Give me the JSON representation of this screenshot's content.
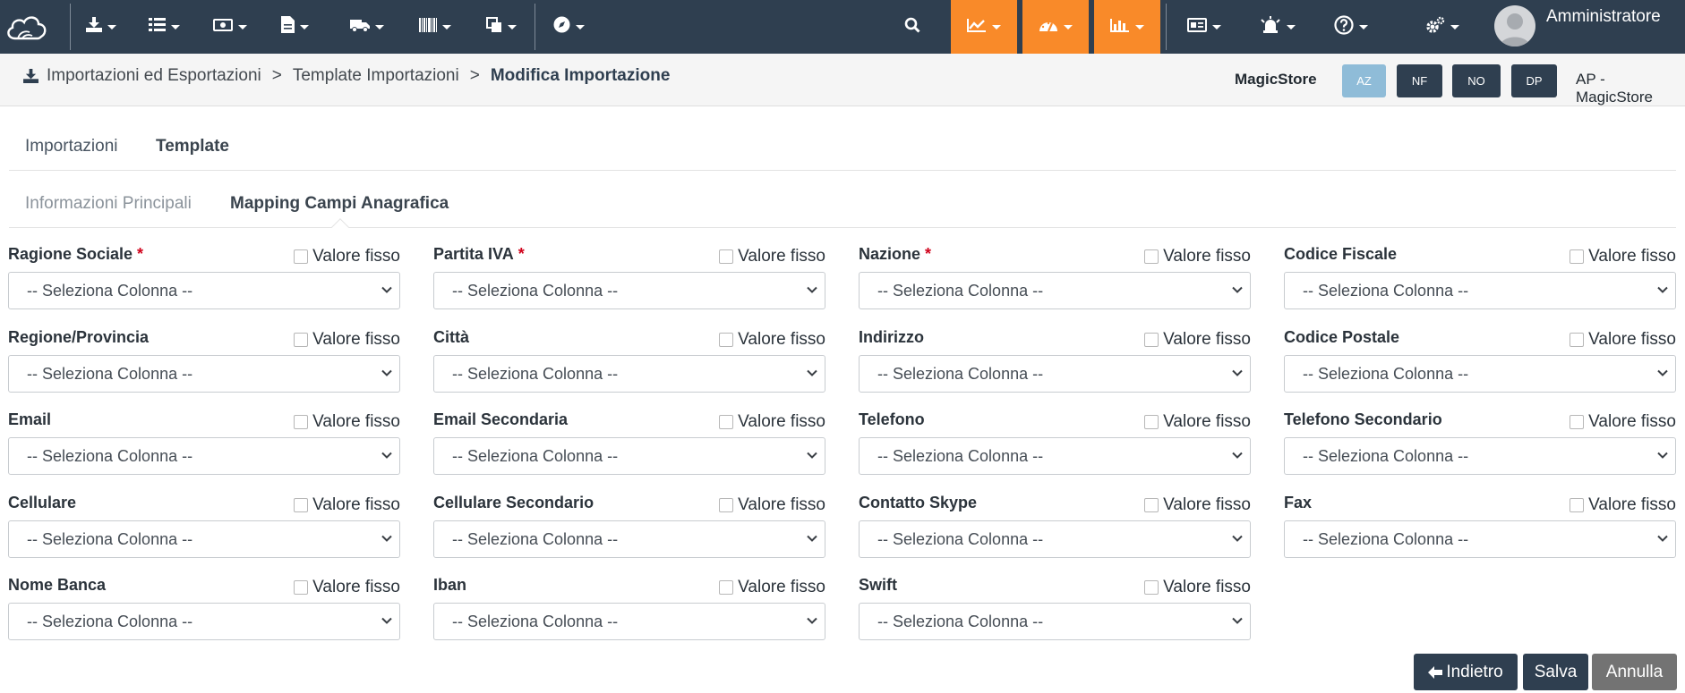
{
  "navbar": {
    "user_name": "Amministratore",
    "accent": "#f98a29",
    "background": "#2f3f50",
    "menu_icons": [
      "download-icon",
      "list-icon",
      "money-icon",
      "document-icon",
      "truck-icon",
      "barcode-icon",
      "copy-icon",
      "compass-icon",
      "search-icon",
      "line-chart-icon",
      "dashboard-icon",
      "bar-chart-icon",
      "id-card-icon",
      "alarm-icon",
      "help-icon",
      "settings-icon"
    ]
  },
  "breadcrumb": {
    "items": [
      "Importazioni ed Esportazioni",
      "Template Importazioni",
      "Modifica Importazione"
    ],
    "separator": ">"
  },
  "store": {
    "name": "MagicStore",
    "code_buttons": [
      "AZ",
      "NF",
      "NO",
      "DP"
    ],
    "code": "AP - MagicStore"
  },
  "tabs": {
    "top": [
      "Importazioni",
      "Template"
    ],
    "sub": [
      "Informazioni Principali",
      "Mapping Campi Anagrafica"
    ]
  },
  "fixed_label": "Valore fisso",
  "select_placeholder": "-- Seleziona Colonna --",
  "fields": [
    {
      "label": "Ragione Sociale",
      "required": "*"
    },
    {
      "label": "Partita IVA",
      "required": "*"
    },
    {
      "label": "Nazione",
      "required": "*"
    },
    {
      "label": "Codice Fiscale",
      "required": ""
    },
    {
      "label": "Regione/Provincia",
      "required": ""
    },
    {
      "label": "Città",
      "required": ""
    },
    {
      "label": "Indirizzo",
      "required": ""
    },
    {
      "label": "Codice Postale",
      "required": ""
    },
    {
      "label": "Email",
      "required": ""
    },
    {
      "label": "Email Secondaria",
      "required": ""
    },
    {
      "label": "Telefono",
      "required": ""
    },
    {
      "label": "Telefono Secondario",
      "required": ""
    },
    {
      "label": "Cellulare",
      "required": ""
    },
    {
      "label": "Cellulare Secondario",
      "required": ""
    },
    {
      "label": "Contatto Skype",
      "required": ""
    },
    {
      "label": "Fax",
      "required": ""
    },
    {
      "label": "Nome Banca",
      "required": ""
    },
    {
      "label": "Iban",
      "required": ""
    },
    {
      "label": "Swift",
      "required": ""
    }
  ],
  "actions": {
    "back": "Indietro",
    "save": "Salva",
    "cancel": "Annulla"
  }
}
